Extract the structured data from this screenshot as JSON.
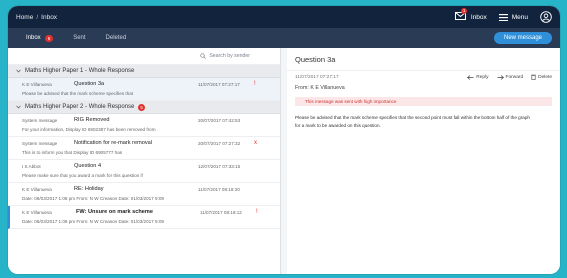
{
  "header": {
    "breadcrumb": [
      "Home",
      "Inbox"
    ],
    "breadcrumb_sep": "/",
    "inbox_label": "Inbox",
    "inbox_badge": "1",
    "menu_label": "Menu"
  },
  "tabs": [
    {
      "label": "Inbox",
      "badge": "6"
    },
    {
      "label": "Sent"
    },
    {
      "label": "Deleted"
    }
  ],
  "new_message_label": "New message",
  "search": {
    "placeholder": "Search by sender"
  },
  "groups": [
    {
      "title": "Maths Higher Paper 1 - Whole Response",
      "badge": ""
    },
    {
      "title": "Maths Higher Paper 2 - Whole Response",
      "badge": "5"
    }
  ],
  "group1_rows": [
    {
      "from": "K E Villanueva",
      "subject": "Question 3a",
      "date": "11/07/2017 07:27:17",
      "flag": "!",
      "preview": "Please be advised that the mark scheme specifies that"
    }
  ],
  "group2_rows": [
    {
      "from": "System message",
      "subject": "RIG Removed",
      "date": "20/07/2017 07:42:53",
      "flag": "",
      "preview": "For your information, Display ID 6902387 has been removed from"
    },
    {
      "from": "System message",
      "subject": "Notification for re-mark removal",
      "date": "20/07/2017 07:27:32",
      "flag": "x",
      "preview": "This is to inform you that Display ID 6905777 has"
    },
    {
      "from": "I S Abbot",
      "subject": "Question 4",
      "date": "12/07/2017 07:33:15",
      "flag": "",
      "preview": "Please make sure that you award a mark for this question if"
    },
    {
      "from": "K E Villanueva",
      "subject": "RE: Holiday",
      "date": "11/07/2017 08:18:20",
      "flag": "",
      "preview": "Date: 06/03/2017 1:08 pm From: N W Creason  Date: 01/03/2017 9:09"
    },
    {
      "from": "K E Villanueva",
      "subject": "FW: Unsure on mark scheme",
      "date": "11/07/2017 08:18:12",
      "flag": "!",
      "preview": "Date: 06/03/2017 1:08 pm From: N W Creason  Date: 01/03/2017 9:09"
    }
  ],
  "message": {
    "subject": "Question 3a",
    "date": "11/07/2017 07:27:17",
    "from_label": "From:",
    "from_name": "K E Villanueva",
    "reply": "Reply",
    "forward": "Forward",
    "delete": "Delete",
    "importance": "This message was sent with high importance",
    "body_line1": "Please be advised that the mark scheme specifies that the second point must fall within the bottom half of the graph",
    "body_line2": "for a mark to be awarded on this question."
  },
  "colors": {
    "topbar": "#12233d",
    "tabsbar": "#2a3b55",
    "accent": "#2f8fd8",
    "badge": "#e0312f",
    "background": "#27b3c8"
  }
}
